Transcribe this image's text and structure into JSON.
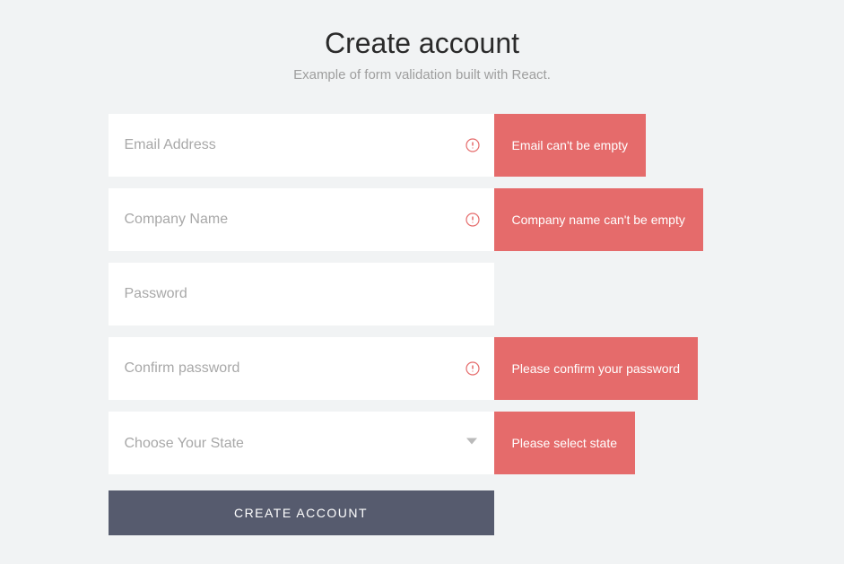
{
  "header": {
    "title": "Create account",
    "subtitle": "Example of form validation built with React."
  },
  "fields": {
    "email": {
      "placeholder": "Email Address",
      "error": "Email can't be empty",
      "has_error": true
    },
    "company": {
      "placeholder": "Company Name",
      "error": "Company name can't be empty",
      "has_error": true
    },
    "password": {
      "placeholder": "Password",
      "has_error": false
    },
    "confirm_password": {
      "placeholder": "Confirm password",
      "error": "Please confirm your password",
      "has_error": true
    },
    "state": {
      "placeholder": "Choose Your State",
      "error": "Please select state",
      "has_error": true
    }
  },
  "submit_label": "CREATE ACCOUNT"
}
